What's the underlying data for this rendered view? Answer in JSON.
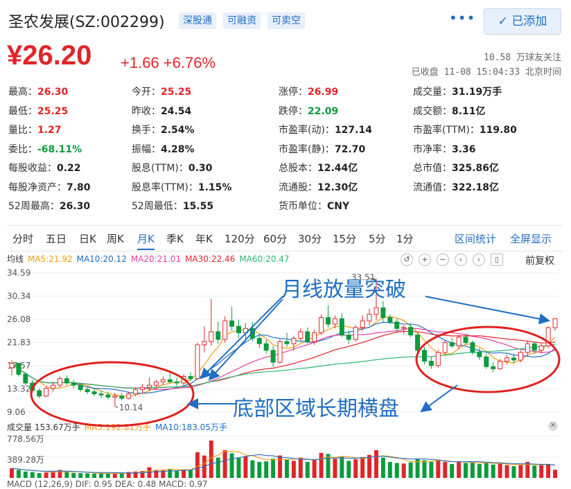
{
  "stock": {
    "name": "圣农发展(SZ:002299)",
    "tags": [
      "深股通",
      "可融资",
      "可卖空"
    ],
    "added_label": "已添加",
    "price": "¥26.20",
    "change": "+1.66 +6.76%",
    "followers": "10.58 万球友关注",
    "status": "已收盘 11-08 15:04:33 北京时间"
  },
  "colors": {
    "up": "#e0252a",
    "down": "#0b9b3c",
    "accent": "#1f6ec2",
    "annotation": "#1f6ec2",
    "circle": "#e0201f"
  },
  "quote": [
    [
      {
        "k": "最高：",
        "v": "26.30",
        "c": "red"
      },
      {
        "k": "今开：",
        "v": "25.25",
        "c": "red"
      },
      {
        "k": "涨停：",
        "v": "26.99",
        "c": "red"
      },
      {
        "k": "成交量：",
        "v": "31.19万手",
        "c": "dark"
      }
    ],
    [
      {
        "k": "最低：",
        "v": "25.25",
        "c": "red"
      },
      {
        "k": "昨收：",
        "v": "24.54",
        "c": "dark"
      },
      {
        "k": "跌停：",
        "v": "22.09",
        "c": "green"
      },
      {
        "k": "成交额：",
        "v": "8.11亿",
        "c": "dark"
      }
    ],
    [
      {
        "k": "量比：",
        "v": "1.27",
        "c": "red"
      },
      {
        "k": "换手：",
        "v": "2.54%",
        "c": "dark"
      },
      {
        "k": "市盈率(动)：",
        "v": "127.14",
        "c": "dark"
      },
      {
        "k": "市盈率(TTM)：",
        "v": "119.80",
        "c": "dark"
      }
    ],
    [
      {
        "k": "委比：",
        "v": "-68.11%",
        "c": "green"
      },
      {
        "k": "振幅：",
        "v": "4.28%",
        "c": "dark"
      },
      {
        "k": "市盈率(静)：",
        "v": "72.70",
        "c": "dark"
      },
      {
        "k": "市净率：",
        "v": "3.36",
        "c": "dark"
      }
    ],
    [
      {
        "k": "每股收益：",
        "v": "0.22",
        "c": "dark"
      },
      {
        "k": "股息(TTM)：",
        "v": "0.30",
        "c": "dark"
      },
      {
        "k": "总股本：",
        "v": "12.44亿",
        "c": "dark"
      },
      {
        "k": "总市值：",
        "v": "325.86亿",
        "c": "dark"
      }
    ],
    [
      {
        "k": "每股净资产：",
        "v": "7.80",
        "c": "dark"
      },
      {
        "k": "股息率(TTM)：",
        "v": "1.15%",
        "c": "dark"
      },
      {
        "k": "流通股：",
        "v": "12.30亿",
        "c": "dark"
      },
      {
        "k": "流通值：",
        "v": "322.18亿",
        "c": "dark"
      }
    ],
    [
      {
        "k": "52周最高：",
        "v": "26.30",
        "c": "dark"
      },
      {
        "k": "52周最低：",
        "v": "15.55",
        "c": "dark"
      },
      {
        "k": "货币单位：",
        "v": "CNY",
        "c": "dark"
      }
    ]
  ],
  "tabs": [
    "分时",
    "五日",
    "日K",
    "周K",
    "月K",
    "季K",
    "年K",
    "120分",
    "60分",
    "30分",
    "15分",
    "5分",
    "1分"
  ],
  "active_tab": "月K",
  "tab_actions": [
    "区间统计",
    "全屏显示"
  ],
  "ma_legend": [
    {
      "label": "均线",
      "color": "#333"
    },
    {
      "label": "MA5:21.92",
      "color": "#f39c12"
    },
    {
      "label": "MA10:20.12",
      "color": "#1f6ec2"
    },
    {
      "label": "MA20:21.01",
      "color": "#e23fa0"
    },
    {
      "label": "MA30:22.46",
      "color": "#e0252a"
    },
    {
      "label": "MA60:20.47",
      "color": "#2bb673"
    }
  ],
  "adjust_label": "前复权",
  "price_axis": [
    "34.59",
    "30.34",
    "26.08",
    "21.83",
    "17.57",
    "13.32",
    "9.06"
  ],
  "price_high_label": "33.51",
  "price_low_label": "10.14",
  "vol_legend": [
    {
      "label": "成交量 153.67万手",
      "color": "#333"
    },
    {
      "label": "MA5:192.81万手",
      "color": "#f39c12"
    },
    {
      "label": "MA10:183.05万手",
      "color": "#1f6ec2"
    }
  ],
  "vol_axis": [
    "778.56万",
    "389.28万"
  ],
  "macd_legend": "MACD (12,26,9)  DIF: 0.95  DEA: 0.48  MACD: 0.97",
  "annotations": {
    "breakout": "月线放量突破",
    "bottom": "底部区域长期横盘"
  },
  "chart_data": {
    "type": "candlestick",
    "ylim": [
      9.06,
      34.59
    ],
    "candles": [
      [
        17.2,
        18.6,
        15.8,
        18.0
      ],
      [
        18.0,
        18.2,
        15.6,
        16.0
      ],
      [
        16.0,
        16.4,
        14.0,
        14.4
      ],
      [
        14.4,
        15.0,
        12.6,
        13.0
      ],
      [
        13.0,
        13.4,
        11.6,
        12.0
      ],
      [
        12.0,
        13.8,
        11.8,
        13.4
      ],
      [
        13.4,
        14.6,
        12.8,
        14.0
      ],
      [
        14.0,
        15.6,
        13.6,
        15.2
      ],
      [
        15.2,
        15.8,
        14.0,
        14.4
      ],
      [
        14.4,
        15.0,
        13.4,
        14.0
      ],
      [
        14.0,
        14.4,
        12.8,
        13.2
      ],
      [
        13.2,
        13.8,
        12.4,
        12.8
      ],
      [
        12.8,
        13.4,
        12.0,
        12.4
      ],
      [
        12.4,
        13.0,
        11.6,
        12.2
      ],
      [
        12.2,
        12.8,
        11.4,
        11.8
      ],
      [
        11.8,
        12.6,
        10.14,
        12.0
      ],
      [
        12.0,
        12.6,
        11.2,
        11.6
      ],
      [
        11.6,
        12.8,
        11.4,
        12.4
      ],
      [
        12.4,
        13.6,
        12.0,
        13.2
      ],
      [
        13.2,
        14.2,
        12.6,
        13.6
      ],
      [
        13.6,
        15.4,
        13.0,
        14.0
      ],
      [
        14.0,
        15.0,
        13.2,
        14.6
      ],
      [
        14.6,
        15.6,
        14.0,
        15.0
      ],
      [
        15.0,
        16.2,
        14.4,
        14.6
      ],
      [
        14.6,
        15.4,
        13.8,
        14.4
      ],
      [
        14.4,
        16.0,
        14.0,
        15.6
      ],
      [
        15.6,
        16.4,
        14.8,
        15.2
      ],
      [
        15.2,
        21.8,
        15.0,
        21.4
      ],
      [
        21.4,
        24.8,
        20.0,
        22.0
      ],
      [
        22.0,
        29.8,
        21.2,
        23.8
      ],
      [
        23.8,
        25.6,
        21.6,
        22.4
      ],
      [
        22.4,
        26.6,
        21.8,
        25.8
      ],
      [
        25.8,
        28.4,
        24.0,
        24.8
      ],
      [
        24.8,
        26.0,
        22.6,
        23.6
      ],
      [
        23.6,
        25.4,
        22.4,
        24.4
      ],
      [
        24.4,
        25.6,
        22.0,
        22.6
      ],
      [
        22.6,
        23.4,
        20.8,
        21.6
      ],
      [
        21.6,
        22.4,
        19.8,
        20.4
      ],
      [
        20.4,
        21.2,
        17.4,
        18.2
      ],
      [
        18.2,
        22.4,
        18.0,
        22.0
      ],
      [
        22.0,
        23.6,
        21.0,
        21.6
      ],
      [
        21.6,
        23.0,
        20.4,
        22.6
      ],
      [
        22.6,
        24.4,
        22.0,
        23.8
      ],
      [
        23.8,
        24.6,
        21.6,
        22.0
      ],
      [
        22.0,
        24.2,
        21.4,
        23.6
      ],
      [
        23.6,
        27.0,
        23.2,
        26.4
      ],
      [
        26.4,
        28.6,
        24.6,
        25.2
      ],
      [
        25.2,
        26.8,
        24.4,
        26.2
      ],
      [
        26.2,
        27.2,
        22.8,
        23.2
      ],
      [
        23.2,
        24.0,
        21.6,
        22.4
      ],
      [
        22.4,
        25.0,
        22.0,
        24.6
      ],
      [
        24.6,
        26.8,
        24.0,
        25.8
      ],
      [
        25.8,
        28.0,
        25.0,
        27.0
      ],
      [
        27.0,
        33.51,
        26.0,
        28.2
      ],
      [
        28.2,
        29.4,
        25.6,
        26.4
      ],
      [
        26.4,
        27.0,
        25.2,
        25.6
      ],
      [
        25.6,
        26.2,
        23.8,
        24.4
      ],
      [
        24.4,
        25.0,
        23.4,
        24.6
      ],
      [
        24.6,
        25.2,
        22.8,
        23.2
      ],
      [
        23.2,
        23.6,
        19.8,
        20.4
      ],
      [
        20.4,
        21.0,
        17.8,
        18.4
      ],
      [
        18.4,
        19.2,
        17.0,
        17.6
      ],
      [
        17.6,
        20.4,
        17.2,
        20.0
      ],
      [
        20.0,
        22.2,
        19.6,
        21.8
      ],
      [
        21.8,
        22.6,
        20.8,
        21.2
      ],
      [
        21.2,
        23.2,
        20.6,
        22.8
      ],
      [
        22.8,
        23.4,
        21.4,
        21.8
      ],
      [
        21.8,
        22.2,
        19.6,
        20.0
      ],
      [
        20.0,
        20.8,
        18.6,
        19.2
      ],
      [
        19.2,
        19.8,
        17.0,
        17.4
      ],
      [
        17.4,
        18.2,
        16.4,
        17.0
      ],
      [
        17.0,
        18.8,
        16.8,
        18.4
      ],
      [
        18.4,
        19.6,
        17.8,
        19.0
      ],
      [
        19.0,
        19.8,
        18.0,
        18.6
      ],
      [
        18.6,
        20.4,
        18.2,
        20.0
      ],
      [
        20.0,
        22.2,
        19.4,
        21.6
      ],
      [
        21.6,
        22.0,
        19.8,
        20.4
      ],
      [
        20.4,
        21.6,
        19.8,
        21.2
      ],
      [
        21.2,
        24.8,
        20.8,
        24.54
      ],
      [
        24.54,
        26.3,
        24.0,
        26.2
      ]
    ],
    "volumes": [
      180,
      150,
      120,
      110,
      90,
      100,
      130,
      150,
      110,
      95,
      90,
      85,
      80,
      85,
      80,
      95,
      90,
      110,
      120,
      130,
      200,
      150,
      140,
      170,
      130,
      160,
      150,
      480,
      420,
      700,
      380,
      520,
      460,
      380,
      400,
      330,
      300,
      310,
      360,
      420,
      340,
      320,
      380,
      300,
      340,
      470,
      450,
      360,
      400,
      320,
      350,
      390,
      430,
      520,
      380,
      300,
      280,
      270,
      290,
      360,
      330,
      300,
      340,
      300,
      260,
      310,
      280,
      290,
      260,
      280,
      250,
      270,
      240,
      220,
      250,
      300,
      230,
      240,
      260,
      153.67
    ]
  }
}
